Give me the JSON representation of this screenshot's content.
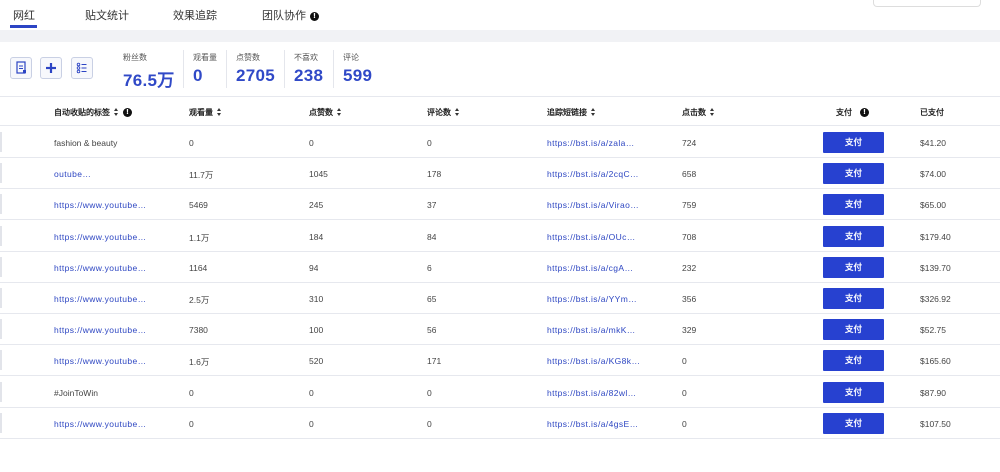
{
  "tabs": [
    {
      "label": "网红",
      "active": true
    },
    {
      "label": "贴文统计",
      "active": false
    },
    {
      "label": "效果追踪",
      "active": false
    },
    {
      "label": "团队协作",
      "active": false,
      "info": true
    }
  ],
  "stats": [
    {
      "label": "粉丝数",
      "value": "76.5万"
    },
    {
      "label": "观看量",
      "value": "0"
    },
    {
      "label": "点赞数",
      "value": "2705"
    },
    {
      "label": "不喜欢",
      "value": "238"
    },
    {
      "label": "评论",
      "value": "599"
    }
  ],
  "columns": {
    "tag": "自动收贴的标签",
    "views": "观看量",
    "likes": "点赞数",
    "comments": "评论数",
    "url": "追踪短链接",
    "clicks": "点击数",
    "pay": "支付",
    "paid": "已支付"
  },
  "pay_label": "支付",
  "accent_color": "#2741d0",
  "rows": [
    {
      "tag": "fashion & beauty",
      "tag_is_link": false,
      "views": "0",
      "likes": "0",
      "comments": "0",
      "url": "https://bst.is/a/zala…",
      "clicks": "724",
      "paid": "$41.20"
    },
    {
      "tag": "outube…",
      "tag_is_link": true,
      "views": "11.7万",
      "likes": "1045",
      "comments": "178",
      "url": "https://bst.is/a/2cqC…",
      "clicks": "658",
      "paid": "$74.00"
    },
    {
      "tag": "https://www.youtube…",
      "tag_is_link": true,
      "views": "5469",
      "likes": "245",
      "comments": "37",
      "url": "https://bst.is/a/Virao…",
      "clicks": "759",
      "paid": "$65.00"
    },
    {
      "tag": "https://www.youtube…",
      "tag_is_link": true,
      "views": "1.1万",
      "likes": "184",
      "comments": "84",
      "url": "https://bst.is/a/OUc…",
      "clicks": "708",
      "paid": "$179.40"
    },
    {
      "tag": "https://www.youtube…",
      "tag_is_link": true,
      "views": "1164",
      "likes": "94",
      "comments": "6",
      "url": "https://bst.is/a/cgA…",
      "clicks": "232",
      "paid": "$139.70"
    },
    {
      "tag": "https://www.youtube…",
      "tag_is_link": true,
      "views": "2.5万",
      "likes": "310",
      "comments": "65",
      "url": "https://bst.is/a/YYm…",
      "clicks": "356",
      "paid": "$326.92"
    },
    {
      "tag": "https://www.youtube…",
      "tag_is_link": true,
      "views": "7380",
      "likes": "100",
      "comments": "56",
      "url": "https://bst.is/a/mkK…",
      "clicks": "329",
      "paid": "$52.75"
    },
    {
      "tag": "https://www.youtube…",
      "tag_is_link": true,
      "views": "1.6万",
      "likes": "520",
      "comments": "171",
      "url": "https://bst.is/a/KG8k…",
      "clicks": "0",
      "paid": "$165.60"
    },
    {
      "tag": "#JoinToWin",
      "tag_is_link": false,
      "views": "0",
      "likes": "0",
      "comments": "0",
      "url": "https://bst.is/a/82wl…",
      "clicks": "0",
      "paid": "$87.90"
    },
    {
      "tag": "https://www.youtube…",
      "tag_is_link": true,
      "views": "0",
      "likes": "0",
      "comments": "0",
      "url": "https://bst.is/a/4gsE…",
      "clicks": "0",
      "paid": "$107.50"
    }
  ]
}
